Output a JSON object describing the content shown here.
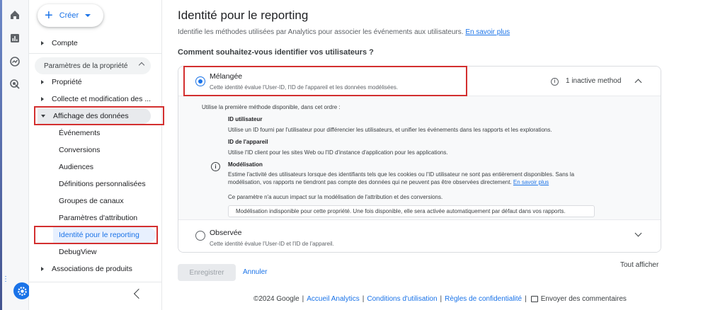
{
  "sidebar": {
    "create_label": "Créer",
    "account_label": "Compte",
    "property_section_label": "Paramètres de la propriété",
    "property_label": "Propriété",
    "collect_label": "Collecte et modification des ...",
    "display_label": "Affichage des données",
    "display_items": [
      "Événements",
      "Conversions",
      "Audiences",
      "Définitions personnalisées",
      "Groupes de canaux",
      "Paramètres d'attribution",
      "Identité pour le reporting",
      "DebugView"
    ],
    "associations_label": "Associations de produits"
  },
  "main": {
    "title": "Identité pour le reporting",
    "description": "Identifie les méthodes utilisées par Analytics pour associer les événements aux utilisateurs.",
    "learn_more": "En savoir plus",
    "question": "Comment souhaitez-vous identifier vos utilisateurs ?",
    "options": {
      "blended": {
        "title": "Mélangée",
        "description": "Cette identité évalue l'User-ID, l'ID de l'appareil et les données modélisées.",
        "inactive": "1 inactive method",
        "selected": true
      },
      "observed": {
        "title": "Observée",
        "description": "Cette identité évalue l'User-ID et l'ID de l'appareil.",
        "selected": false
      }
    },
    "details": {
      "intro": "Utilise la première méthode disponible, dans cet ordre :",
      "user_id_title": "ID utilisateur",
      "user_id_desc": "Utilise un ID fourni par l'utilisateur pour différencier les utilisateurs, et unifier les événements dans les rapports et les explorations.",
      "device_id_title": "ID de l'appareil",
      "device_id_desc": "Utilise l'ID client pour les sites Web ou l'ID d'instance d'application pour les applications.",
      "modeling_title": "Modélisation",
      "modeling_desc_1": "Estime l'activité des utilisateurs lorsque des identifiants tels que les cookies ou l'ID utilisateur ne sont pas entièrement disponibles. Sans la",
      "modeling_desc_2": "modélisation, vos rapports ne tiendront pas compte des données qui ne peuvent pas être observées directement.",
      "modeling_link": "En savoir plus",
      "attribution_note": "Ce paramètre n'a aucun impact sur la modélisation de l'attribution et des conversions.",
      "unavailable_note": "Modélisation indisponible pour cette propriété. Une fois disponible, elle sera activée automatiquement par défaut dans vos rapports."
    },
    "save_label": "Enregistrer",
    "cancel_label": "Annuler",
    "show_all_label": "Tout afficher"
  },
  "footer": {
    "copyright": "©2024 Google",
    "analytics_home": "Accueil Analytics",
    "terms": "Conditions d'utilisation",
    "privacy": "Règles de confidentialité",
    "feedback": "Envoyer des commentaires"
  },
  "colors": {
    "accent": "#1a73e8",
    "highlight_box": "#d32f2f"
  }
}
